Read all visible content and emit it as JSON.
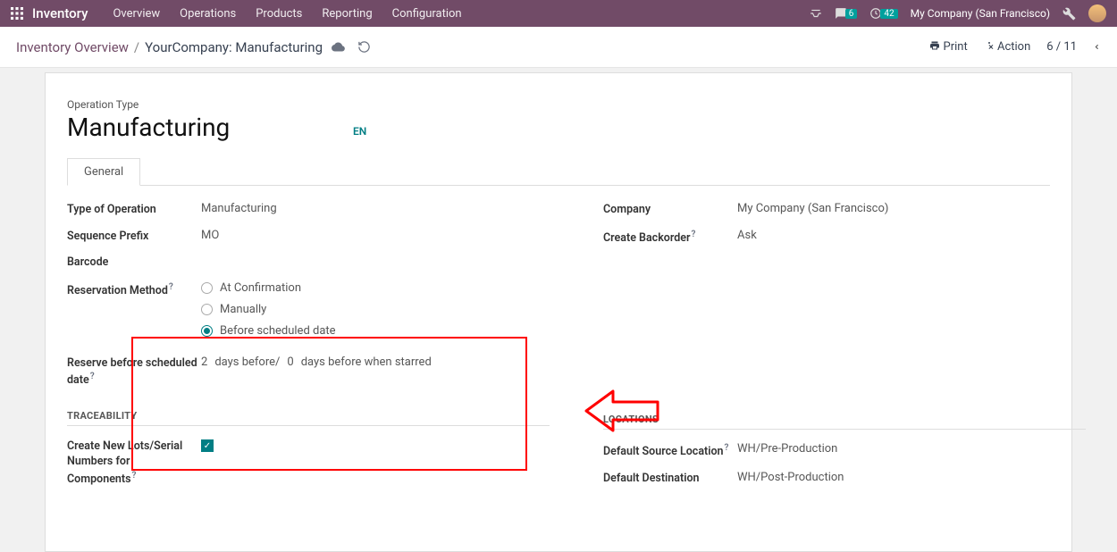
{
  "navbar": {
    "brand": "Inventory",
    "links": [
      "Overview",
      "Operations",
      "Products",
      "Reporting",
      "Configuration"
    ],
    "msg_badge": "6",
    "clock_badge": "42",
    "company": "My Company (San Francisco)"
  },
  "subbar": {
    "bc_root": "Inventory Overview",
    "bc_current": "YourCompany: Manufacturing",
    "print": "Print",
    "action": "Action",
    "pager": "6 / 11"
  },
  "record": {
    "operation_type_lbl": "Operation Type",
    "name": "Manufacturing",
    "lang": "EN"
  },
  "tabs": {
    "general": "General"
  },
  "left": {
    "type_of_operation_lbl": "Type of Operation",
    "type_of_operation_val": "Manufacturing",
    "sequence_prefix_lbl": "Sequence Prefix",
    "sequence_prefix_val": "MO",
    "barcode_lbl": "Barcode",
    "res_method_lbl": "Reservation Method",
    "res_opt1": "At Confirmation",
    "res_opt2": "Manually",
    "res_opt3": "Before scheduled date",
    "reserve_before_lbl": "Reserve before scheduled date",
    "days_a": "2",
    "days_a_txt": "days before/",
    "days_b": "0",
    "days_b_txt": "days before when starred"
  },
  "right": {
    "company_lbl": "Company",
    "company_val": "My Company (San Francisco)",
    "create_backorder_lbl": "Create Backorder",
    "create_backorder_val": "Ask"
  },
  "trace": {
    "header": "TRACEABILITY",
    "create_lots_lbl": "Create New Lots/Serial Numbers for Components"
  },
  "loc": {
    "header": "LOCATIONS",
    "default_src_lbl": "Default Source Location",
    "default_src_val": "WH/Pre-Production",
    "default_dest_lbl": "Default Destination",
    "default_dest_val": "WH/Post-Production"
  }
}
